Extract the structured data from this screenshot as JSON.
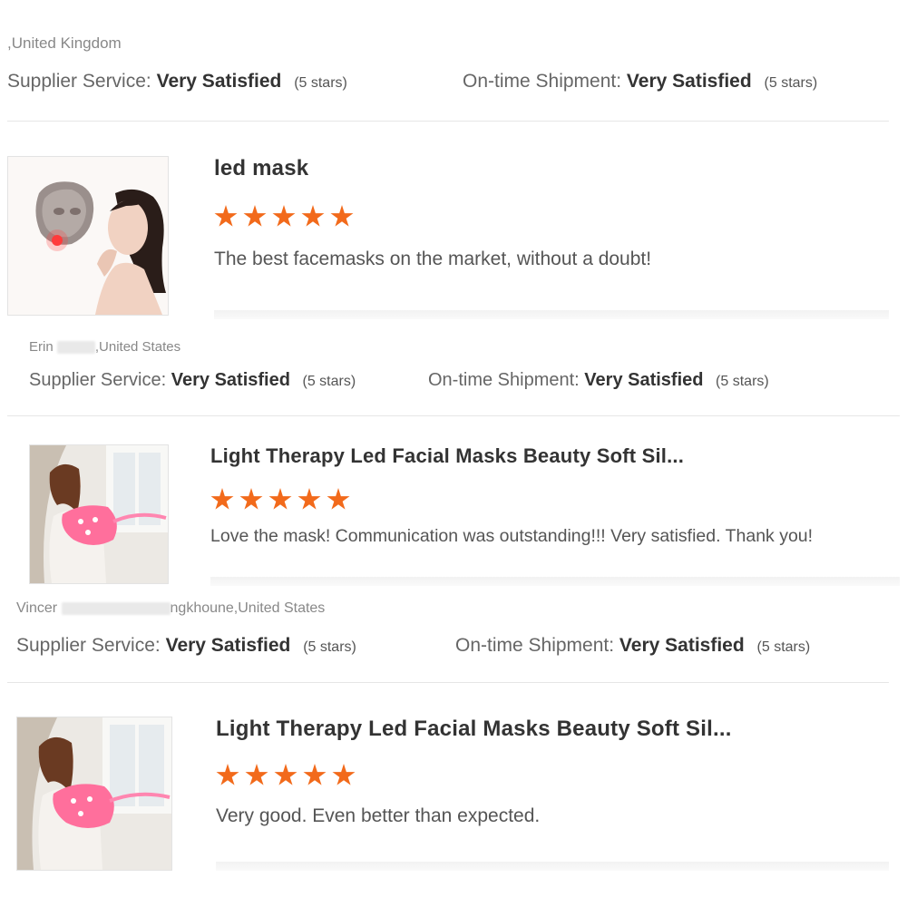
{
  "colors": {
    "star": "#f26a1b",
    "divider": "#e6e6e6",
    "text_bold": "#333333"
  },
  "labels": {
    "supplier_service": "Supplier Service:",
    "ontime_shipment": "On-time Shipment:",
    "very_satisfied": "Very Satisfied",
    "five_stars": "(5 stars)"
  },
  "reviews": [
    {
      "reviewer_suffix": ",United Kingdom",
      "supplier_service": "Very Satisfied",
      "ontime_shipment": "Very Satisfied",
      "supplier_stars_note": "(5 stars)",
      "shipment_stars_note": "(5 stars)"
    },
    {
      "product_title": "led mask",
      "rating": 5,
      "comment": "The best facemasks on the market, without a doubt!",
      "thumbnail_icon": "led-mask-woman-image",
      "reviewer_prefix": "Erin",
      "reviewer_suffix": ",United States",
      "supplier_service": "Very Satisfied",
      "ontime_shipment": "Very Satisfied",
      "supplier_stars_note": "(5 stars)",
      "shipment_stars_note": "(5 stars)"
    },
    {
      "product_title": "Light Therapy Led Facial Masks Beauty Soft Sil...",
      "rating": 5,
      "comment": "Love the mask! Communication was outstanding!!! Very satisfied. Thank you!",
      "thumbnail_icon": "pink-mask-woman-image",
      "reviewer_prefix": "Vincer",
      "reviewer_suffix": "ngkhoune,United States",
      "supplier_service": "Very Satisfied",
      "ontime_shipment": "Very Satisfied",
      "supplier_stars_note": "(5 stars)",
      "shipment_stars_note": "(5 stars)"
    },
    {
      "product_title": "Light Therapy Led Facial Masks Beauty Soft Sil...",
      "rating": 5,
      "comment": "Very good. Even better than expected.",
      "thumbnail_icon": "pink-mask-woman-image"
    }
  ]
}
